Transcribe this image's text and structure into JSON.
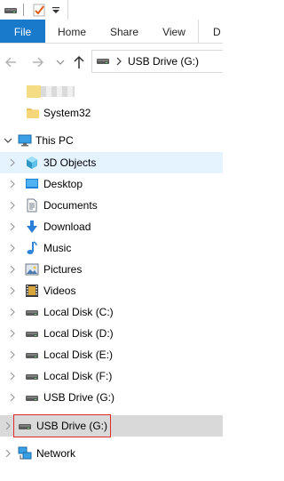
{
  "ribbon": {
    "tabs": [
      "File",
      "Home",
      "Share",
      "View",
      "D"
    ]
  },
  "address": {
    "path": "USB Drive (G:)"
  },
  "tree": {
    "quick_access": [
      "System32"
    ],
    "this_pc": {
      "label": "This PC",
      "children": [
        "3D Objects",
        "Desktop",
        "Documents",
        "Download",
        "Music",
        "Pictures",
        "Videos",
        "Local Disk (C:)",
        "Local Disk (D:)",
        "Local Disk (E:)",
        "Local Disk (F:)",
        "USB Drive (G:)"
      ]
    },
    "usb_root": "USB Drive (G:)",
    "network": "Network"
  },
  "icons": {
    "folder": "folder-icon",
    "pc": "computer-icon",
    "objects3d": "cube-icon",
    "desktop": "desktop-icon",
    "documents": "document-icon",
    "download": "download-arrow-icon",
    "music": "music-note-icon",
    "pictures": "picture-icon",
    "videos": "film-icon",
    "drive": "drive-icon",
    "network": "network-icon"
  },
  "colors": {
    "file_tab": "#1979ca",
    "hover_row": "#e5f3ff",
    "selected_row": "#d9d9d9",
    "highlight_box": "#e02a2a"
  }
}
